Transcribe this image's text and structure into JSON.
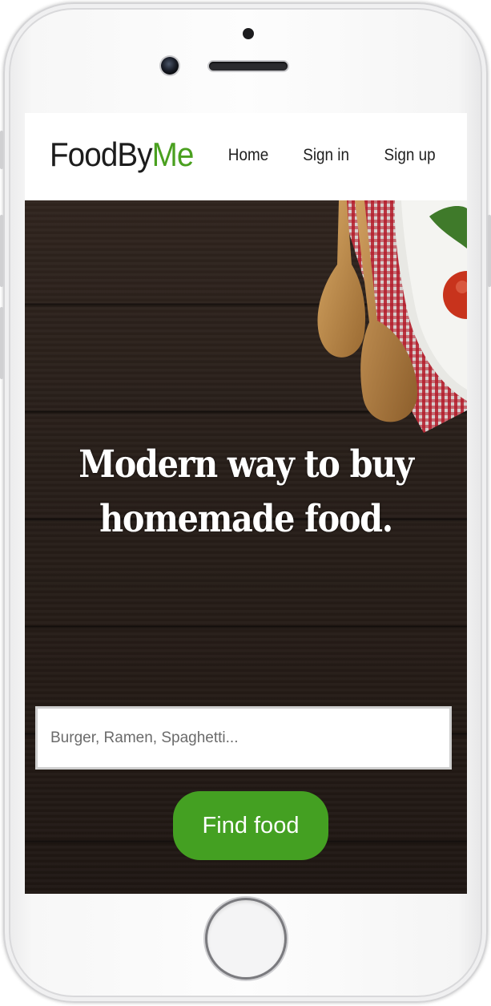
{
  "brand": {
    "part1": "FoodBy",
    "part2": "Me",
    "accent_color": "#4aa01f"
  },
  "nav": {
    "links": [
      "Home",
      "Sign in",
      "Sign up"
    ]
  },
  "hero": {
    "headline_line1": "Modern way to buy",
    "headline_line2": "homemade food.",
    "search": {
      "placeholder": "Burger, Ramen, Spaghetti...",
      "value": ""
    },
    "cta_label": "Find food",
    "cta_color": "#44a022",
    "background": "dark wood table with wooden spoons, checkered cloth and plate with tomato"
  },
  "device": {
    "type": "phone",
    "color": "silver-white"
  }
}
